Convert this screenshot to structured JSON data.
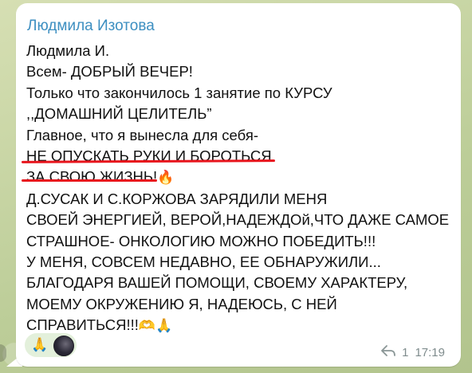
{
  "message": {
    "sender": "Людмила Изотова",
    "lines": [
      "Людмила И.",
      "Всем- ДОБРЫЙ ВЕЧЕР!",
      "Только что закончилось 1 занятие по КУРСУ",
      ",,ДОМАШНИЙ ЦЕЛИТЕЛЬ”",
      "Главное, что я вынесла для себя-",
      "НЕ ОПУСКАТЬ РУКИ  И БОРОТЬСЯ",
      "ЗА СВОЮ ЖИЗНЬ!",
      "Д.СУСАК И С.КОРЖОВА ЗАРЯДИЛИ МЕНЯ",
      "СВОЕЙ ЭНЕРГИЕЙ, ВЕРОЙ,НАДЕЖДОй,ЧТО ДАЖЕ САМОЕ",
      "СТРАШНОЕ- ОНКОЛОГИЮ МОЖНО ПОБЕДИТЬ!!!",
      "У МЕНЯ, СОВСЕМ НЕДАВНО, ЕЕ ОБНАРУЖИЛИ...",
      "БЛАГОДАРЯ ВАШЕЙ ПОМОЩИ, СВОЕМУ ХАРАКТЕРУ,",
      "МОЕМУ ОКРУЖЕНИЮ Я, НАДЕЮСЬ, С НЕЙ",
      "СПРАВИТЬСЯ!!!"
    ],
    "emoji_fire": "🔥",
    "emoji_end": "🫶🙏",
    "reaction_emoji": "🙏",
    "reply_count": "1",
    "time": "17:19",
    "accent_color": "#3d8fc1",
    "underline_color": "#e8141c"
  }
}
